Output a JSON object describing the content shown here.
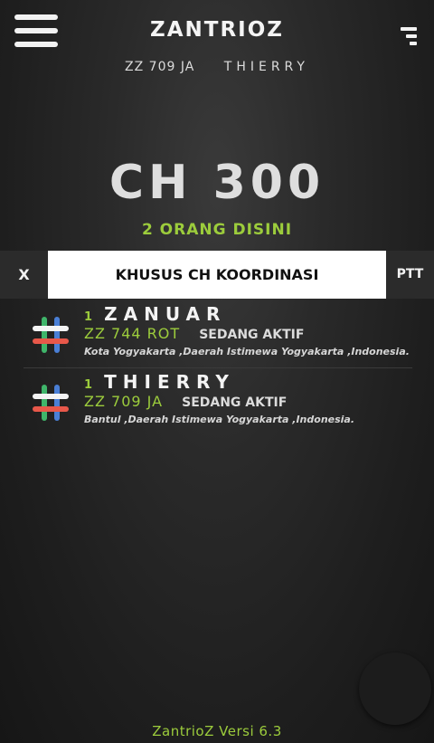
{
  "header": {
    "app_title": "ZANTRIOZ",
    "menu_icon": "hamburger-menu-icon",
    "signal_icon": "signal-bars-icon"
  },
  "user": {
    "callsign": "ZZ 709 JA",
    "name": "THIERRY"
  },
  "channel": {
    "title": "CH 300",
    "count_text": "2 ORANG DISINI",
    "name": "KHUSUS CH KOORDINASI"
  },
  "controls": {
    "close_label": "X",
    "ptt_label": "PTT"
  },
  "members": [
    {
      "number": "1",
      "name": "ZANUAR",
      "callsign": "ZZ 744 ROT",
      "status": "SEDANG AKTIF",
      "location": "Kota Yogyakarta ,Daerah Istimewa Yogyakarta ,Indonesia.",
      "icon": "hashtag-icon"
    },
    {
      "number": "1",
      "name": "THIERRY",
      "callsign": "ZZ 709 JA",
      "status": "SEDANG AKTIF",
      "location": "Bantul ,Daerah Istimewa Yogyakarta ,Indonesia.",
      "icon": "hashtag-icon"
    }
  ],
  "footer": {
    "version": "ZantrioZ Versi 6.3"
  },
  "colors": {
    "accent_green": "#9ccc3c",
    "background": "#222222",
    "text_light": "#f2f2f2",
    "channel_box": "#ffffff",
    "hash_red": "#e8584a",
    "hash_green": "#3fb56a",
    "hash_blue": "#4a7fd6",
    "hash_white": "#f4f4f4"
  }
}
